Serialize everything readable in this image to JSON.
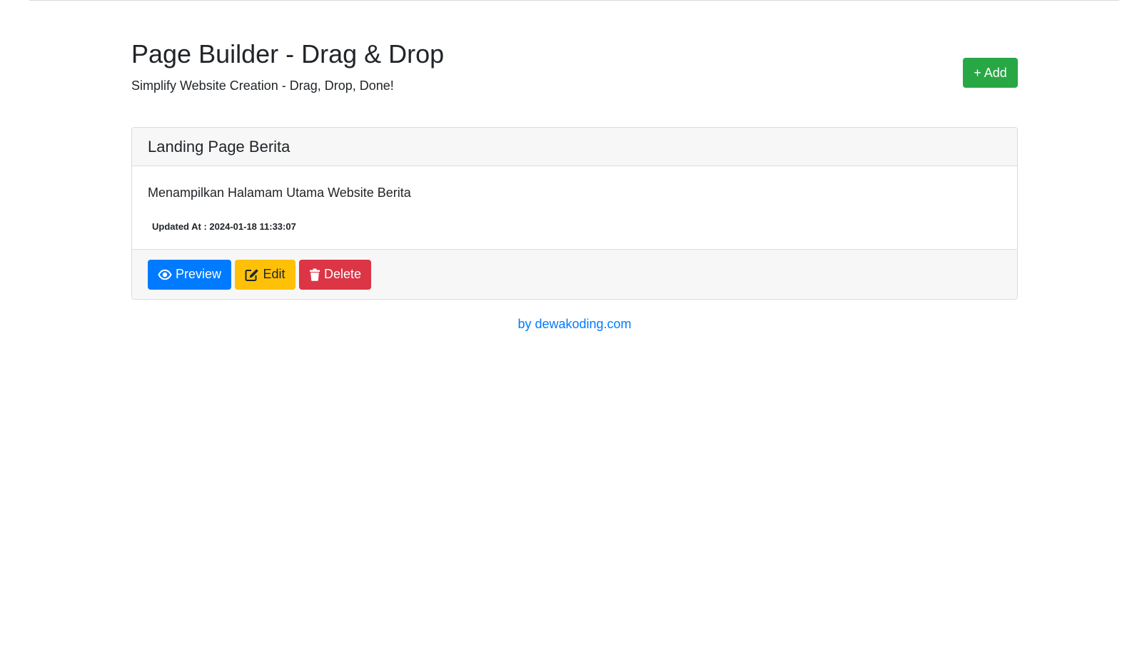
{
  "header": {
    "title": "Page Builder - Drag & Drop",
    "subtitle": "Simplify Website Creation - Drag, Drop, Done!",
    "add_button_label": "+ Add"
  },
  "pages": [
    {
      "title": "Landing Page Berita",
      "description": "Menampilkan Halamam Utama Website Berita",
      "updated": "Updated At : 2024-01-18 11:33:07",
      "actions": {
        "preview_label": "Preview",
        "edit_label": "Edit",
        "delete_label": "Delete"
      }
    }
  ],
  "footer": {
    "credit": "by dewakoding.com"
  },
  "icons": {
    "preview": "eye-icon",
    "edit": "edit-icon",
    "delete": "trash-icon"
  },
  "colors": {
    "add": "#28a745",
    "preview": "#007bff",
    "edit": "#ffc107",
    "delete": "#dc3545",
    "link": "#007bff"
  }
}
